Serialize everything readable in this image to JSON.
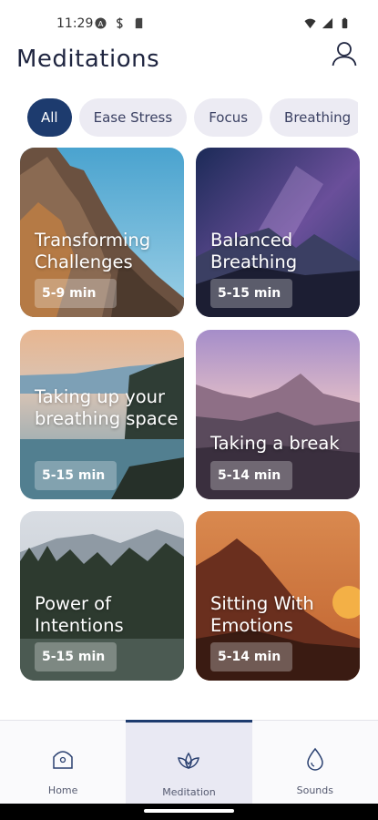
{
  "status": {
    "time": "11:29"
  },
  "header": {
    "title": "Meditations"
  },
  "chips": [
    {
      "label": "All",
      "active": true
    },
    {
      "label": "Ease Stress",
      "active": false
    },
    {
      "label": "Focus",
      "active": false
    },
    {
      "label": "Breathing",
      "active": false
    }
  ],
  "cards": [
    {
      "title": "Transforming Challenges",
      "duration": "5-9 min"
    },
    {
      "title": "Balanced Breathing",
      "duration": "5-15 min"
    },
    {
      "title": "Taking up your breathing space",
      "duration": "5-15 min"
    },
    {
      "title": "Taking a break",
      "duration": "5-14 min"
    },
    {
      "title": "Power of Intentions",
      "duration": "5-15 min"
    },
    {
      "title": "Sitting With Emotions",
      "duration": "5-14 min"
    }
  ],
  "nav": [
    {
      "label": "Home"
    },
    {
      "label": "Meditation"
    },
    {
      "label": "Sounds"
    }
  ],
  "colors": {
    "accent": "#1d3b6e",
    "chip_bg": "#ecebf3",
    "nav_active_bg": "#e9e9f3"
  }
}
